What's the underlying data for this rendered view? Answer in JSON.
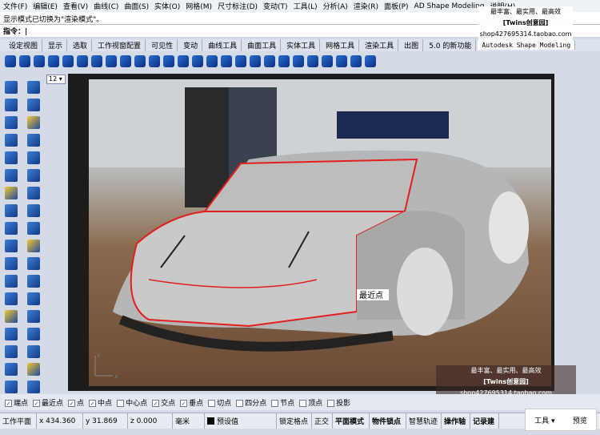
{
  "menu": [
    "文件(F)",
    "编辑(E)",
    "查看(V)",
    "曲线(C)",
    "曲面(S)",
    "实体(O)",
    "网格(M)",
    "尺寸标注(D)",
    "变动(T)",
    "工具(L)",
    "分析(A)",
    "渲染(R)",
    "面板(P)",
    "AD Shape Modeling",
    "说明(H)"
  ],
  "command_history": "显示模式已切换为\"渲染模式\"。",
  "command_prompt": "指令：",
  "tabs": [
    "设定视图",
    "显示",
    "选取",
    "工作视窗配置",
    "可见性",
    "变动",
    "曲线工具",
    "曲面工具",
    "实体工具",
    "网格工具",
    "渲染工具",
    "出图",
    "5.0 的新功能",
    "Autodesk Shape Modeling"
  ],
  "viewport": {
    "label": "12",
    "snap_tooltip": "最近点",
    "axis_x": "x",
    "axis_y": "y"
  },
  "watermark": {
    "line1": "最丰富、最实用、最高效",
    "line2": "[Twins创意园]",
    "line3": "shop427695314.taobao.com"
  },
  "osnap": [
    {
      "label": "端点",
      "checked": true
    },
    {
      "label": "最近点",
      "checked": true
    },
    {
      "label": "点",
      "checked": true
    },
    {
      "label": "中点",
      "checked": true
    },
    {
      "label": "中心点",
      "checked": false
    },
    {
      "label": "交点",
      "checked": true
    },
    {
      "label": "垂点",
      "checked": true
    },
    {
      "label": "切点",
      "checked": false
    },
    {
      "label": "四分点",
      "checked": false
    },
    {
      "label": "节点",
      "checked": false
    },
    {
      "label": "顶点",
      "checked": false
    },
    {
      "label": "投影",
      "checked": false
    }
  ],
  "status": {
    "cplane": "工作平面",
    "x": "x 434.360",
    "y": "y 31.869",
    "z": "z 0.000",
    "units": "毫米",
    "layer": "预设值",
    "grid_snap": "锁定格点",
    "ortho": "正交",
    "planar": "平面模式",
    "osnap": "物件锁点",
    "smarttrack": "智慧轨迹",
    "gumball": "操作轴",
    "record": "记录建"
  },
  "popup": {
    "tools": "工具 ▾",
    "preview": "预览"
  },
  "colors": {
    "curve": "#e0201e",
    "surface": "#c8c8c8"
  }
}
